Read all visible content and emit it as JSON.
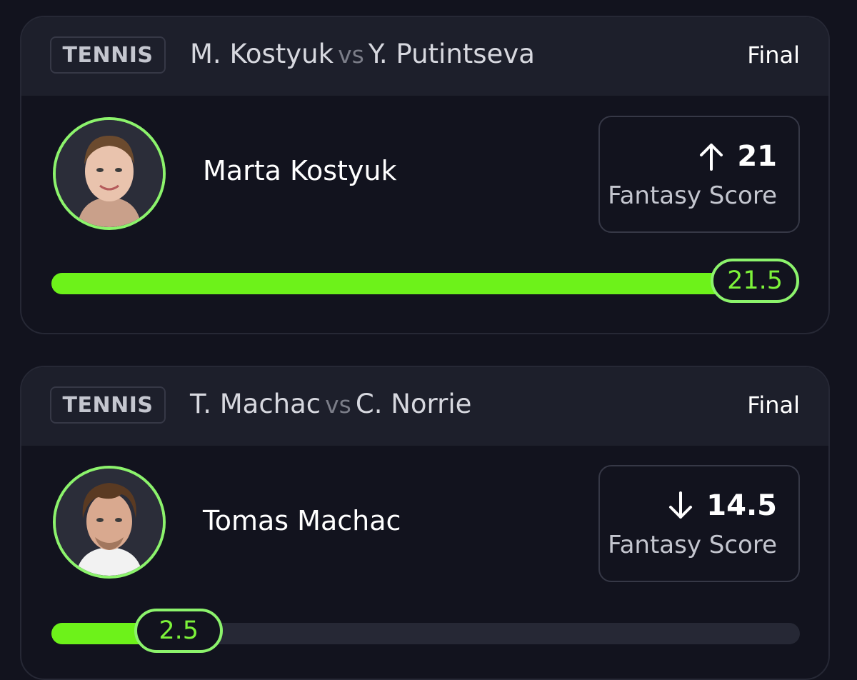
{
  "cards": [
    {
      "sport": "TENNIS",
      "player_a": "M. Kostyuk",
      "vs": "vs",
      "player_b": "Y. Putintseva",
      "status": "Final",
      "player_name": "Marta Kostyuk",
      "avatar_icon": "player-avatar-icon",
      "direction": "up",
      "score": "21",
      "score_label": "Fantasy Score",
      "line": "21.5",
      "line_fraction": 0.94
    },
    {
      "sport": "TENNIS",
      "player_a": "T. Machac",
      "vs": "vs",
      "player_b": "C. Norrie",
      "status": "Final",
      "player_name": "Tomas Machac",
      "avatar_icon": "player-avatar-icon",
      "direction": "down",
      "score": "14.5",
      "score_label": "Fantasy Score",
      "line": "2.5",
      "line_fraction": 0.17
    }
  ],
  "colors": {
    "accent": "#6df21a",
    "accent_border": "#8cf36c",
    "background": "#12131e",
    "header": "#1d1f2b"
  }
}
